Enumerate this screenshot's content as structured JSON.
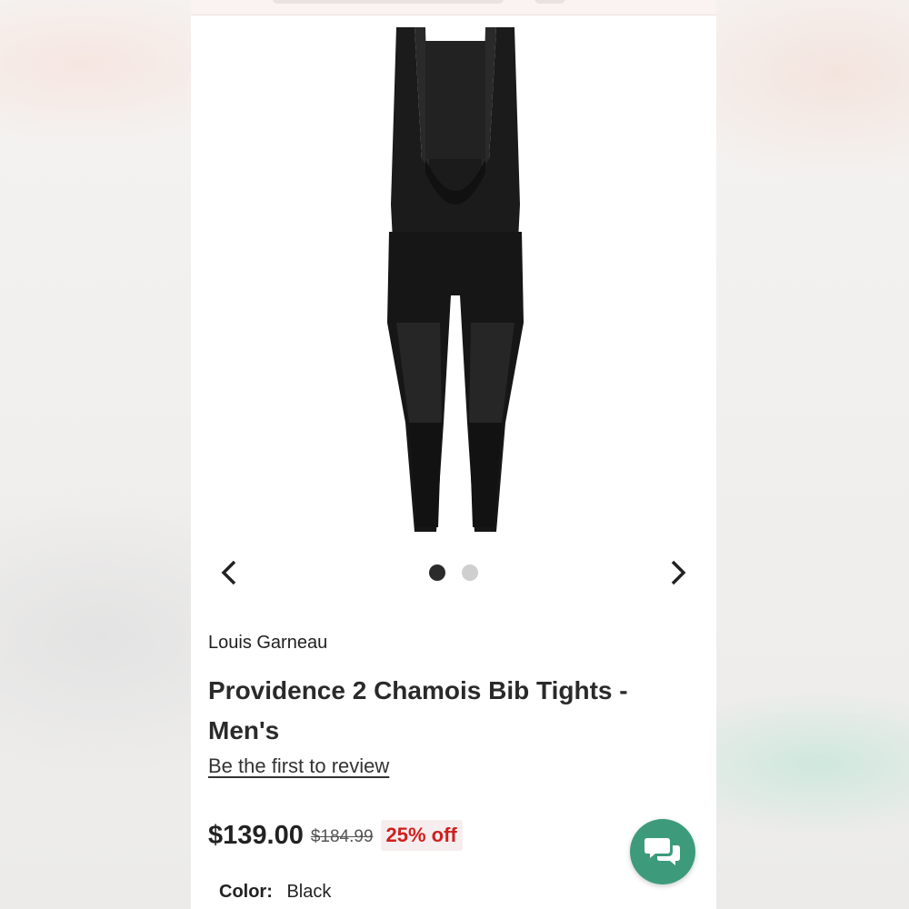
{
  "product": {
    "brand": "Louis Garneau",
    "title": "Providence 2 Chamois Bib Tights - Men's",
    "review_link": "Be the first to review",
    "price": "$139.00",
    "original_price": "$184.99",
    "discount": "25% off",
    "color_label": "Color:",
    "color_value": "Black"
  },
  "carousel": {
    "image_count": 2,
    "active_index": 0,
    "prev_icon": "chevron-left-icon",
    "next_icon": "chevron-right-icon"
  },
  "chat": {
    "icon": "chat-bubbles-icon"
  },
  "colors": {
    "accent_green": "#3d9b7c",
    "discount_red": "#d01f1f"
  }
}
